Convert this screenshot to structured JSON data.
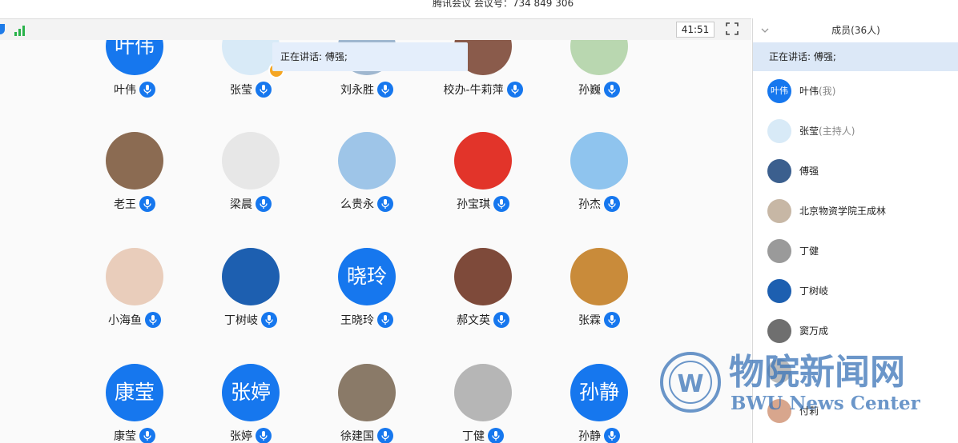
{
  "window": {
    "title": "腾讯会议 会议号：734 849 306"
  },
  "toolbar": {
    "timer": "41:51"
  },
  "speaking_bubble": "正在讲话: 傅强;",
  "grid_members": [
    {
      "name": "叶伟",
      "avatar_text": "叶伟",
      "type": "text"
    },
    {
      "name": "张莹",
      "type": "photo",
      "color": "#d8eaf7",
      "host": true
    },
    {
      "name": "刘永胜",
      "type": "photo",
      "color": "#9fb7cf"
    },
    {
      "name": "校办-牛莉萍",
      "type": "photo",
      "color": "#8a5b4b"
    },
    {
      "name": "孙巍",
      "type": "photo",
      "color": "#b9d7b0"
    },
    {
      "name": "老王",
      "type": "photo",
      "color": "#8b6b52"
    },
    {
      "name": "梁晨",
      "type": "photo",
      "color": "#e7e7e7"
    },
    {
      "name": "么贵永",
      "type": "photo",
      "color": "#9ec5e8"
    },
    {
      "name": "孙宝琪",
      "type": "photo",
      "color": "#e2342a"
    },
    {
      "name": "孙杰",
      "type": "photo",
      "color": "#8fc4ee"
    },
    {
      "name": "小海鱼",
      "type": "photo",
      "color": "#e9cdbb"
    },
    {
      "name": "丁树岐",
      "type": "photo",
      "color": "#1d5fb0"
    },
    {
      "name": "王晓玲",
      "avatar_text": "晓玲",
      "type": "text"
    },
    {
      "name": "郝文英",
      "type": "photo",
      "color": "#7e4a3a"
    },
    {
      "name": "张霖",
      "type": "photo",
      "color": "#c98b3a"
    },
    {
      "name": "康莹",
      "avatar_text": "康莹",
      "type": "text"
    },
    {
      "name": "张婷",
      "avatar_text": "张婷",
      "type": "text"
    },
    {
      "name": "徐建国",
      "type": "photo",
      "color": "#8a7a68"
    },
    {
      "name": "丁健",
      "type": "photo",
      "color": "#b6b6b6"
    },
    {
      "name": "孙静",
      "avatar_text": "孙静",
      "type": "text"
    }
  ],
  "sidebar": {
    "header": "成员(36人)",
    "speaking": "正在讲话: 傅强;",
    "members": [
      {
        "name": "叶伟",
        "role": "(我)",
        "avatar_text": "叶伟",
        "type": "text"
      },
      {
        "name": "张莹",
        "role": "(主持人)",
        "type": "photo",
        "color": "#d8eaf7"
      },
      {
        "name": "傅强",
        "role": "",
        "type": "photo",
        "color": "#3b5f8e"
      },
      {
        "name": "北京物资学院王成林",
        "role": "",
        "type": "photo",
        "color": "#c7b7a5"
      },
      {
        "name": "丁健",
        "role": "",
        "type": "photo",
        "color": "#9a9a9a"
      },
      {
        "name": "丁树岐",
        "role": "",
        "type": "photo",
        "color": "#1d5fb0"
      },
      {
        "name": "窦万成",
        "role": "",
        "type": "photo",
        "color": "#6f6f6f"
      },
      {
        "name": "",
        "role": "",
        "type": "photo",
        "color": "#bcbcbc"
      },
      {
        "name": "付莉",
        "role": "",
        "type": "photo",
        "color": "#d8a68d"
      }
    ]
  },
  "watermark": {
    "title": "物院新闻网",
    "subtitle": "BWU News Center"
  },
  "colors": {
    "accent": "#1677ee",
    "signal": "#29b34a"
  }
}
